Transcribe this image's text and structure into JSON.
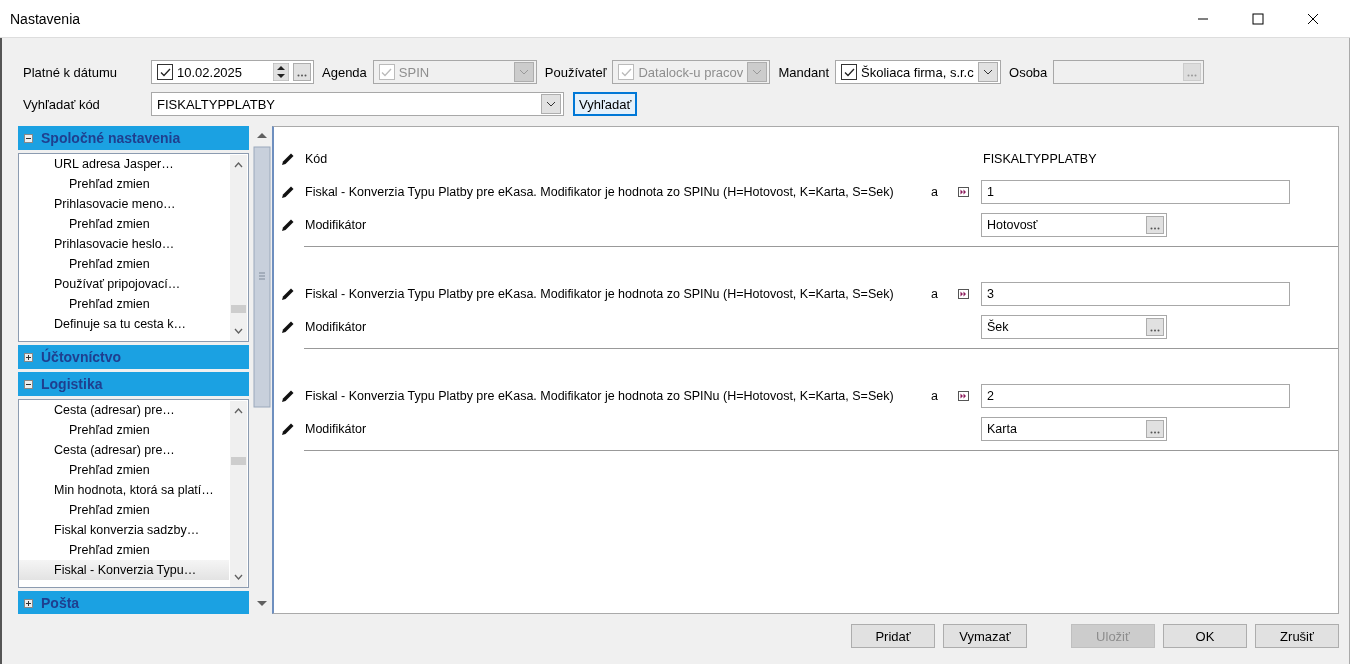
{
  "window": {
    "title": "Nastavenia"
  },
  "filters": [
    {
      "kind": "date",
      "label": "Platné k dátumu",
      "checked": true,
      "value": "10.02.2025",
      "disabled": false
    },
    {
      "kind": "combo",
      "label": "Agenda",
      "checked": true,
      "value": "SPIN",
      "disabled": true
    },
    {
      "kind": "combo",
      "label": "Používateľ",
      "checked": true,
      "value": "Datalock-u pracov",
      "disabled": true
    },
    {
      "kind": "combo",
      "label": "Mandant",
      "checked": true,
      "value": "Školiaca firma, s.r.c",
      "disabled": false
    },
    {
      "kind": "picker",
      "label": "Osoba",
      "disabled": true
    }
  ],
  "search": {
    "label": "Vyhľadať kód",
    "value": "FISKALTYPPLATBY",
    "button": "Vyhľadať"
  },
  "sidebar": {
    "sections": [
      {
        "title": "Spoločné nastavenia",
        "expanded": true,
        "items": [
          {
            "label": "URL adresa Jasper…",
            "selected": false,
            "children": [
              {
                "label": "Prehľad zmien",
                "selected": false
              }
            ]
          },
          {
            "label": "Prihlasovacie meno…",
            "selected": false,
            "children": [
              {
                "label": "Prehľad zmien",
                "selected": false
              }
            ]
          },
          {
            "label": "Prihlasovacie heslo…",
            "selected": false,
            "children": [
              {
                "label": "Prehľad zmien",
                "selected": false
              }
            ]
          },
          {
            "label": "Používať pripojovací…",
            "selected": false,
            "children": [
              {
                "label": "Prehľad zmien",
                "selected": false
              }
            ]
          },
          {
            "label": "Definuje sa tu cesta k…",
            "selected": false
          }
        ]
      },
      {
        "title": "Účtovníctvo",
        "expanded": false
      },
      {
        "title": "Logistika",
        "expanded": true,
        "items": [
          {
            "label": "Cesta (adresar) pre…",
            "selected": false,
            "children": [
              {
                "label": "Prehľad zmien",
                "selected": false
              }
            ]
          },
          {
            "label": "Cesta (adresar) pre…",
            "selected": false,
            "children": [
              {
                "label": "Prehľad zmien",
                "selected": false
              }
            ]
          },
          {
            "label": "Min hodnota, ktorá sa platí…",
            "selected": false,
            "children": [
              {
                "label": "Prehľad zmien",
                "selected": false
              }
            ]
          },
          {
            "label": "Fiskal konverzia sadzby…",
            "selected": false,
            "children": [
              {
                "label": "Prehľad zmien",
                "selected": false
              }
            ]
          },
          {
            "label": "Fiskal - Konverzia Typu…",
            "selected": true
          }
        ]
      },
      {
        "title": "Pošta",
        "expanded": false
      }
    ]
  },
  "content": {
    "groups": [
      {
        "rows": [
          {
            "kind": "text",
            "label": "Kód",
            "value": "FISKALTYPPLATBY"
          },
          {
            "kind": "field",
            "label": "Fiskal - Konverzia Typu Platby pre eKasa. Modifikator je hodnota zo SPINu (H=Hotovost, K=Karta, S=Sek)",
            "suffix": "a",
            "value": "1"
          },
          {
            "kind": "picker",
            "label": "Modifikátor",
            "value": "Hotovosť"
          }
        ]
      },
      {
        "rows": [
          {
            "kind": "field",
            "label": "Fiskal - Konverzia Typu Platby pre eKasa. Modifikator je hodnota zo SPINu (H=Hotovost, K=Karta, S=Sek)",
            "suffix": "a",
            "value": "3"
          },
          {
            "kind": "picker",
            "label": "Modifikátor",
            "value": "Šek"
          }
        ]
      },
      {
        "rows": [
          {
            "kind": "field",
            "label": "Fiskal - Konverzia Typu Platby pre eKasa. Modifikator je hodnota zo SPINu (H=Hotovost, K=Karta, S=Sek)",
            "suffix": "a",
            "value": "2"
          },
          {
            "kind": "picker",
            "label": "Modifikátor",
            "value": "Karta"
          }
        ]
      }
    ]
  },
  "buttons": [
    {
      "label": "Pridať",
      "disabled": false
    },
    {
      "label": "Vymazať",
      "disabled": false
    },
    {
      "label": "Uložiť",
      "disabled": true
    },
    {
      "label": "OK",
      "disabled": false
    },
    {
      "label": "Zrušiť",
      "disabled": false
    }
  ]
}
